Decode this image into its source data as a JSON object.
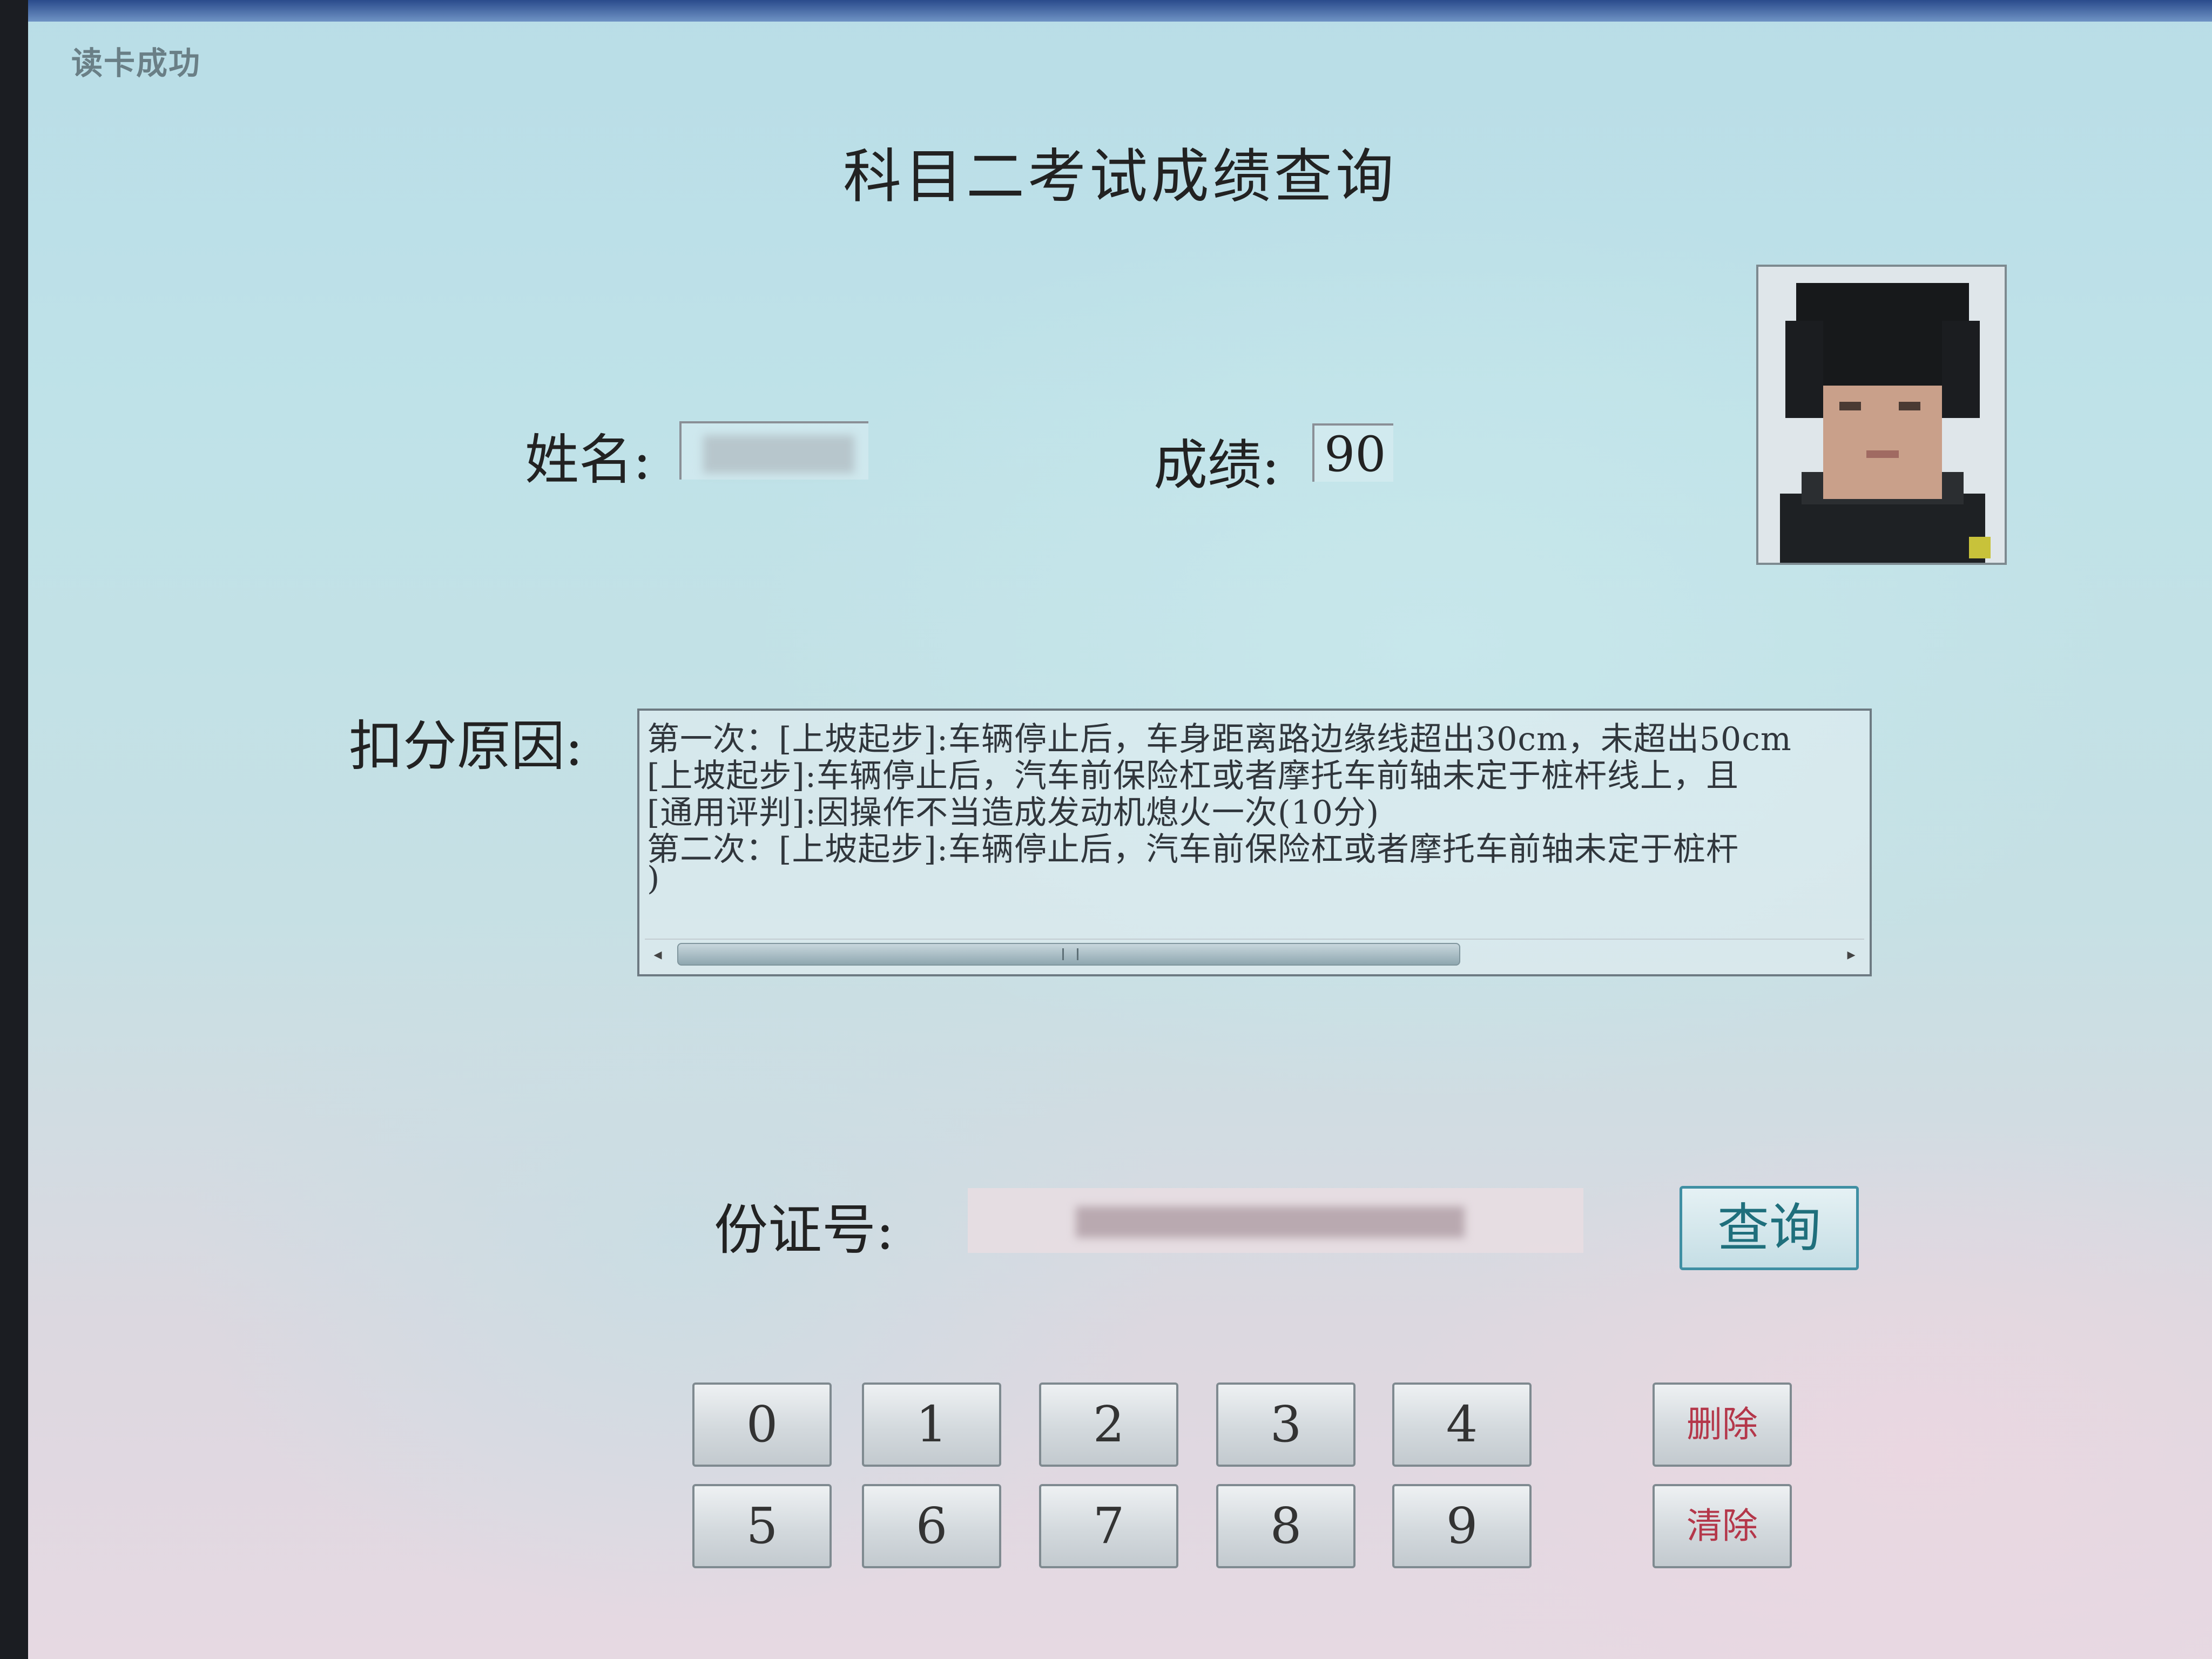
{
  "status_message": "读卡成功",
  "title": "科目二考试成绩查询",
  "name_field": {
    "label": "姓名:",
    "value": ""
  },
  "score_field": {
    "label": "成绩:",
    "value": "90"
  },
  "deduction": {
    "label": "扣分原因:",
    "lines": [
      "第一次：[上坡起步]:车辆停止后，车身距离路边缘线超出30cm，未超出50cm",
      "[上坡起步]:车辆停止后，汽车前保险杠或者摩托车前轴未定于桩杆线上，且",
      "[通用评判]:因操作不当造成发动机熄火一次(10分)",
      "第二次：[上坡起步]:车辆停止后，汽车前保险杠或者摩托车前轴未定于桩杆",
      ")"
    ]
  },
  "id_field": {
    "label": "份证号:",
    "value": ""
  },
  "query_button": "查询",
  "keypad": {
    "row1": [
      "0",
      "1",
      "2",
      "3",
      "4"
    ],
    "row2": [
      "5",
      "6",
      "7",
      "8",
      "9"
    ],
    "delete_label": "删除",
    "clear_label": "清除"
  }
}
